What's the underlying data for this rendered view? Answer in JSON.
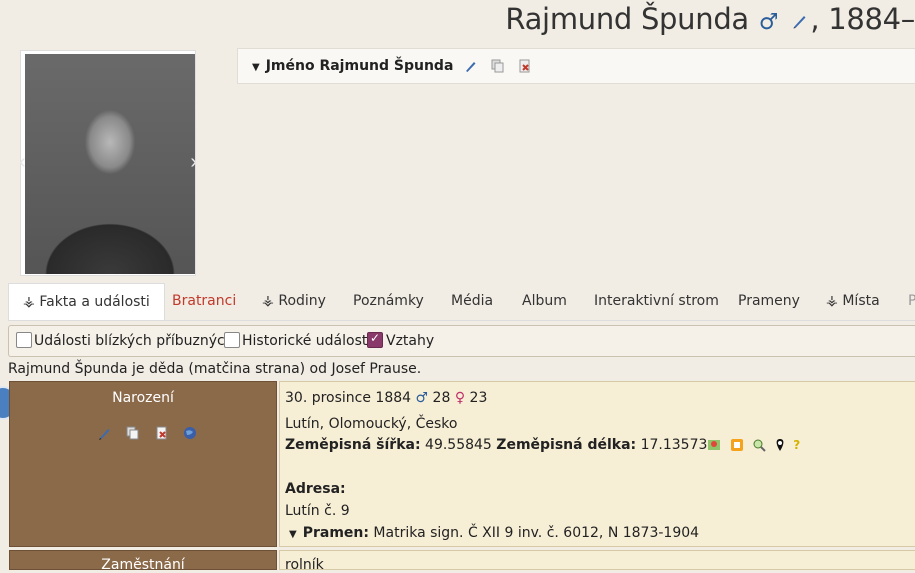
{
  "header": {
    "name": "Rajmund Špunda",
    "sex_symbol": "♂",
    "years": ", 1884–"
  },
  "name_box": {
    "label": "Jméno Rajmund Špunda"
  },
  "tabs": [
    {
      "label": "⚶ Fakta a události",
      "active": true
    },
    {
      "label": "Bratranci"
    },
    {
      "label": "⚶ Rodiny"
    },
    {
      "label": "Poznámky"
    },
    {
      "label": "Média"
    },
    {
      "label": "Album"
    },
    {
      "label": "Interaktivní strom"
    },
    {
      "label": "Prameny"
    },
    {
      "label": "⚶ Místa"
    },
    {
      "label": "P"
    }
  ],
  "filters": [
    {
      "label": "Události blízkých příbuzných",
      "checked": false
    },
    {
      "label": "Historické události",
      "checked": false
    },
    {
      "label": "Vztahy",
      "checked": true
    }
  ],
  "relation_text": "Rajmund Špunda je děda (matčina strana) od Josef Prause.",
  "facts": [
    {
      "event": "Narození",
      "date": "30. prosince 1884",
      "father_age": "28",
      "mother_age": "23",
      "place": "Lutín, Olomoucký, Česko",
      "lat_label": "Zeměpisná šířka:",
      "lat": "49.55845",
      "lon_label": "Zeměpisná délka:",
      "lon": "17.13573",
      "address_label": "Adresa:",
      "address": "Lutín č. 9",
      "source_label": "Pramen:",
      "source": "Matrika sign. Č XII 9 inv. č. 6012, N 1873-1904"
    },
    {
      "event": "Zaměstnání",
      "value": "rolník"
    }
  ],
  "colors": {
    "accent_brown": "#8b6a4a",
    "cell_bg": "#f7eed6",
    "page_bg": "#f2ede4",
    "male_blue": "#2a5d9a",
    "female_pink": "#c0306a"
  }
}
